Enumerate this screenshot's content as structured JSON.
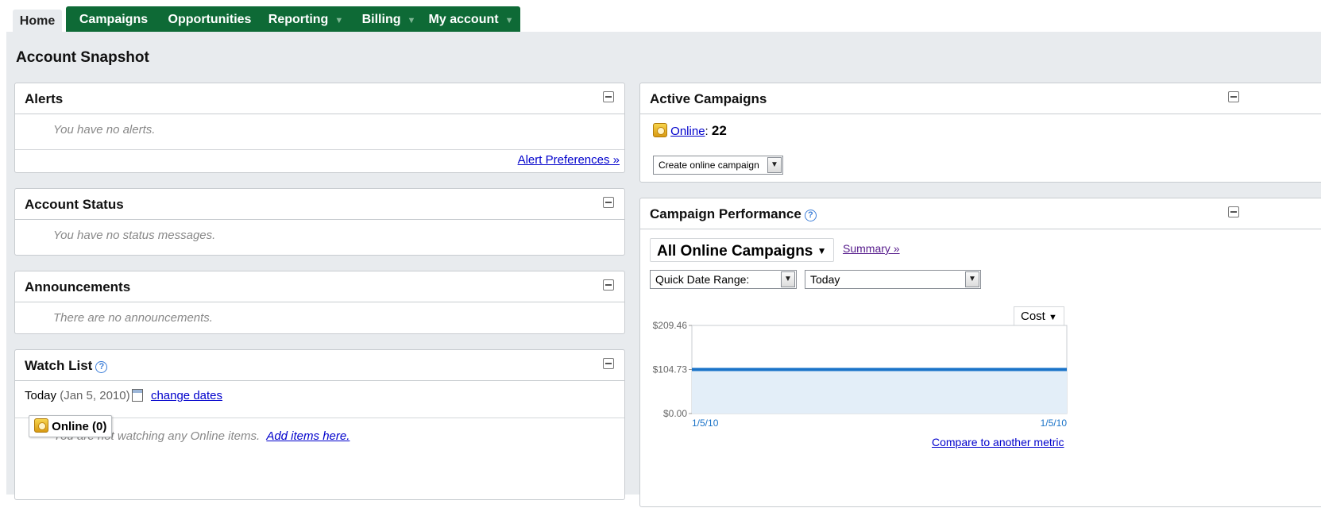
{
  "tabs": [
    {
      "label": "Home",
      "active": true
    },
    {
      "label": "Campaigns"
    },
    {
      "label": "Opportunities"
    },
    {
      "label": "Reporting",
      "dropdown": true
    },
    {
      "label": "Billing",
      "dropdown": true
    },
    {
      "label": "My account",
      "dropdown": true
    }
  ],
  "page_title": "Account Snapshot",
  "alerts": {
    "title": "Alerts",
    "message": "You have no alerts.",
    "link": "Alert Preferences »"
  },
  "account_status": {
    "title": "Account Status",
    "message": "You have no status messages."
  },
  "announcements": {
    "title": "Announcements",
    "message": "There are no announcements."
  },
  "watch_list": {
    "title": "Watch List",
    "today_label": "Today",
    "date": "(Jan 5, 2010)",
    "change_dates": "change dates",
    "online_badge": "Online (0)",
    "message": "You are not watching any Online items.",
    "add_link": "Add items here."
  },
  "active_campaigns": {
    "title": "Active Campaigns",
    "online_link": "Online",
    "separator": ":",
    "count": "22",
    "create_select": "Create online campaign"
  },
  "campaign_performance": {
    "title": "Campaign Performance",
    "campaign_select": "All Online Campaigns",
    "summary_link": "Summary »",
    "date_range_select": "Quick Date Range:",
    "period_select": "Today",
    "metric_select": "Cost",
    "compare_link": "Compare to another metric"
  },
  "chart_data": {
    "type": "area",
    "x": [
      "1/5/10",
      "1/5/10"
    ],
    "y_ticks": [
      "$0.00",
      "$104.73",
      "$209.46"
    ],
    "ylim": [
      0,
      209.46
    ],
    "series": [
      {
        "values": [
          104.73,
          104.73
        ]
      }
    ],
    "line_color": "#1a73c8",
    "fill_color": "#e3eef8"
  }
}
